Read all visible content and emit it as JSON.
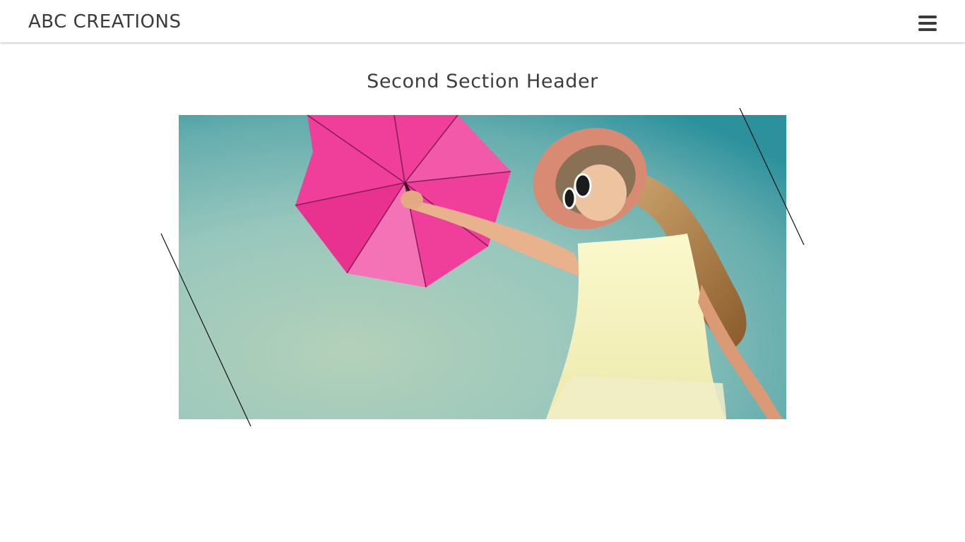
{
  "header": {
    "brand": "ABC CREATIONS",
    "menu_icon": "hamburger-menu-icon"
  },
  "section": {
    "title": "Second Section Header"
  },
  "hero_image": {
    "subject": "woman-with-pink-umbrella-photo",
    "colors": {
      "sky_light": "#c2dcc2",
      "sky_dark": "#2f9aa4",
      "umbrella": "#ef3f9a",
      "dress": "#f4f1b5",
      "hair": "#b98a4c",
      "skin": "#e9b48f",
      "hat": "#d98a73"
    }
  }
}
